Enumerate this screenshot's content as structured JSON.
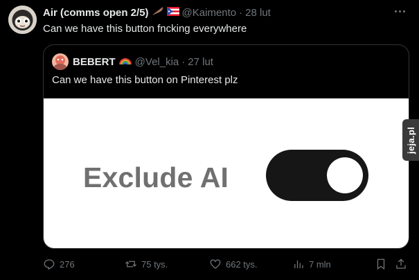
{
  "tweet": {
    "author_name": "Air (comms open 2/5)",
    "handle": "@Kaimento",
    "separator": "·",
    "time": "28 lut",
    "text": "Can we have this button fncking everywhere",
    "more_icon": "more-horizontal-icon"
  },
  "quote": {
    "author_name": "BEBERT",
    "handle": "@Vel_kia",
    "separator": "·",
    "time": "27 lut",
    "text": "Can we have this button on Pinterest plz",
    "image": {
      "label": "Exclude AI",
      "toggle_state": "on"
    }
  },
  "actions": {
    "replies": "276",
    "reposts": "75 tys.",
    "likes": "662 tys.",
    "views": "7 mln"
  },
  "watermark": "jeja.pl",
  "colors": {
    "background": "#000000",
    "text": "#e7e9ea",
    "muted": "#71767b",
    "border": "#2f3336"
  }
}
